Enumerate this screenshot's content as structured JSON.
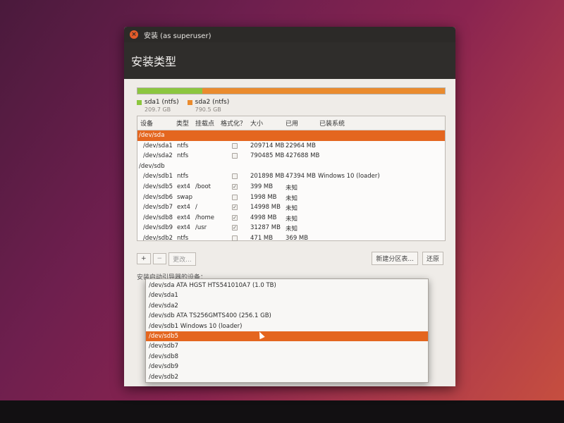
{
  "window": {
    "title": "安装 (as superuser)",
    "close_glyph": "×"
  },
  "header": {
    "title": "安装类型"
  },
  "partition_bar": {
    "segments": [
      {
        "color": "#8cc63f",
        "fraction": 0.21,
        "label": "sda1 (ntfs)"
      },
      {
        "color": "#ea8b2e",
        "fraction": 0.79,
        "label": "sda2 (ntfs)"
      }
    ],
    "legend": [
      {
        "label": "sda1 (ntfs)",
        "size": "209.7 GB",
        "color": "#8cc63f"
      },
      {
        "label": "sda2 (ntfs)",
        "size": "790.5 GB",
        "color": "#ea8b2e"
      }
    ]
  },
  "table": {
    "columns": [
      "设备",
      "类型",
      "挂载点",
      "格式化？",
      "大小",
      "已用",
      "已装系统"
    ],
    "rows": [
      {
        "device": "/dev/sda",
        "type": "",
        "mount": "",
        "format": null,
        "size": "",
        "used": "",
        "system": "",
        "is_disk": true,
        "selected": true
      },
      {
        "device": "/dev/sda1",
        "type": "ntfs",
        "mount": "",
        "format": false,
        "size": "209714 MB",
        "used": "22964 MB",
        "system": ""
      },
      {
        "device": "/dev/sda2",
        "type": "ntfs",
        "mount": "",
        "format": false,
        "size": "790485 MB",
        "used": "427688 MB",
        "system": ""
      },
      {
        "device": "/dev/sdb",
        "type": "",
        "mount": "",
        "format": null,
        "size": "",
        "used": "",
        "system": "",
        "is_disk": true
      },
      {
        "device": "/dev/sdb1",
        "type": "ntfs",
        "mount": "",
        "format": false,
        "size": "201898 MB",
        "used": "47394 MB",
        "system": "Windows 10 (loader)"
      },
      {
        "device": "/dev/sdb5",
        "type": "ext4",
        "mount": "/boot",
        "format": true,
        "size": "399 MB",
        "used": "未知",
        "system": ""
      },
      {
        "device": "/dev/sdb6",
        "type": "swap",
        "mount": "",
        "format": false,
        "size": "1998 MB",
        "used": "未知",
        "system": ""
      },
      {
        "device": "/dev/sdb7",
        "type": "ext4",
        "mount": "/",
        "format": true,
        "size": "14998 MB",
        "used": "未知",
        "system": ""
      },
      {
        "device": "/dev/sdb8",
        "type": "ext4",
        "mount": "/home",
        "format": true,
        "size": "4998 MB",
        "used": "未知",
        "system": ""
      },
      {
        "device": "/dev/sdb9",
        "type": "ext4",
        "mount": "/usr",
        "format": true,
        "size": "31287 MB",
        "used": "未知",
        "system": ""
      },
      {
        "device": "/dev/sdb2",
        "type": "ntfs",
        "mount": "",
        "format": false,
        "size": "471 MB",
        "used": "369 MB",
        "system": ""
      }
    ]
  },
  "toolbar": {
    "add": "+",
    "remove": "−",
    "change": "更改...",
    "new_table": "新建分区表...",
    "revert": "还原"
  },
  "boot_loader": {
    "label": "安装启动引导器的设备：",
    "options": [
      "/dev/sda    ATA HGST HTS541010A7 (1.0 TB)",
      "/dev/sda1",
      "/dev/sda2",
      "/dev/sdb    ATA TS256GMTS400 (256.1 GB)",
      "/dev/sdb1 Windows 10 (loader)",
      "/dev/sdb5",
      "/dev/sdb7",
      "/dev/sdb8",
      "/dev/sdb9",
      "/dev/sdb2"
    ],
    "selected_index": 5
  },
  "colors": {
    "accent": "#e4661f",
    "header_bg": "#2f2d2b",
    "window_bg": "#efece8"
  }
}
